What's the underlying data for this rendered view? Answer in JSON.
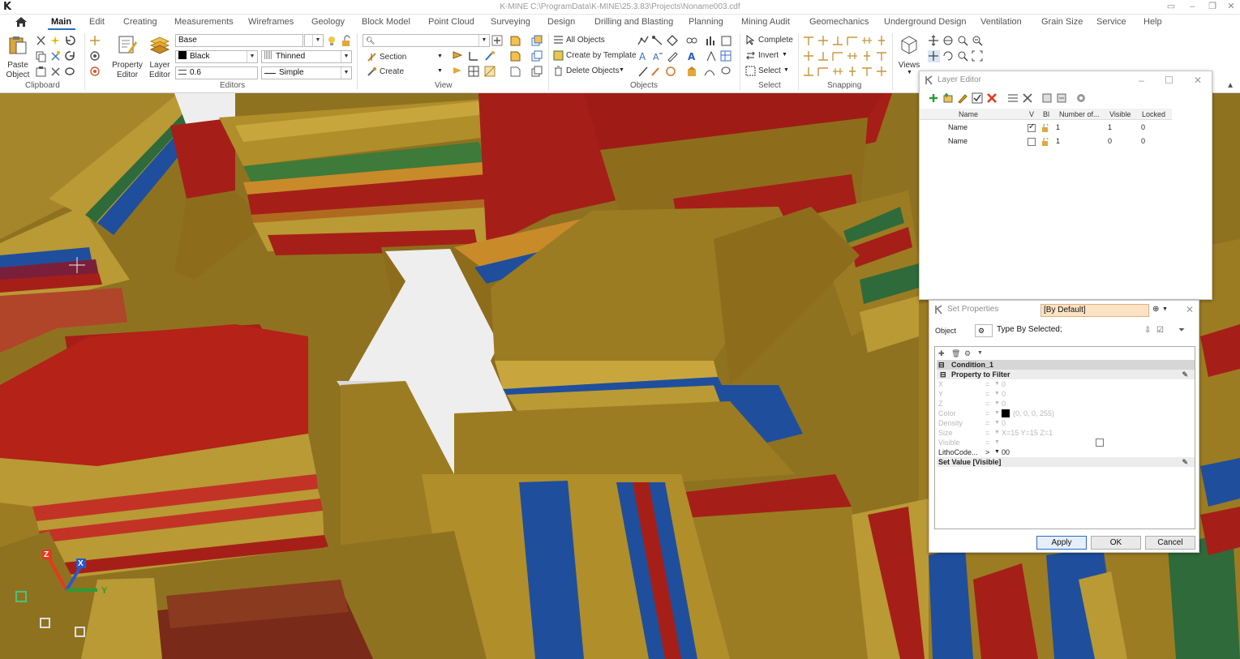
{
  "window": {
    "title": "K-MINE C:\\ProgramData\\K-MINE\\25.3.83\\Projects\\Noname003.cdf",
    "logo": "K"
  },
  "menu": {
    "items": [
      "Main",
      "Edit",
      "Creating",
      "Measurements",
      "Wireframes",
      "Geology",
      "Block Model",
      "Point Cloud",
      "Surveying",
      "Design",
      "Drilling and Blasting",
      "Planning",
      "Mining Audit",
      "Geomechanics",
      "Underground Design",
      "Ventilation",
      "Grain Size",
      "Service",
      "Help"
    ],
    "active": "Main"
  },
  "ribbon": {
    "clipboard": {
      "label": "Clipboard",
      "paste_label": "Paste\nObject"
    },
    "editors": {
      "label": "Editors",
      "property_editor": "Property\nEditor",
      "layer_editor": "Layer\nEditor",
      "layer_combo": "Base",
      "color_combo": "Black",
      "line_type_combo": "Thinned",
      "width_combo": "0.6",
      "style_combo": "Simple"
    },
    "view": {
      "label": "View",
      "search_value": "",
      "section": "Section",
      "create": "Create"
    },
    "objects": {
      "label": "Objects",
      "all_objects": "All Objects",
      "create_by_template": "Create by Template",
      "delete_objects": "Delete Objects"
    },
    "select": {
      "label": "Select",
      "complete": "Complete",
      "invert": "Invert",
      "select": "Select"
    },
    "snapping": {
      "label": "Snapping"
    },
    "views": {
      "label": "Views"
    }
  },
  "layer_editor": {
    "title": "Layer Editor",
    "columns": [
      "Name",
      "V",
      "Bl",
      "Number of...",
      "Visible",
      "Locked"
    ],
    "rows": [
      {
        "name": "Name",
        "v": true,
        "number": "1",
        "visible": "1",
        "locked": "0"
      },
      {
        "name": "Name",
        "v": false,
        "number": "1",
        "visible": "0",
        "locked": "0"
      }
    ]
  },
  "set_properties": {
    "title": "Set Properties",
    "preset": "[By Default]",
    "object_label": "Object",
    "object_value": "Type By Selected;",
    "condition": "Condition_1",
    "property_to_filter": "Property to Filter",
    "props": [
      {
        "name": "X",
        "op": "=",
        "value": "0",
        "enabled": false
      },
      {
        "name": "Y",
        "op": "=",
        "value": "0",
        "enabled": false
      },
      {
        "name": "Z",
        "op": "=",
        "value": "0",
        "enabled": false
      },
      {
        "name": "Color",
        "op": "=",
        "value": "(0, 0, 0, 255)",
        "enabled": false
      },
      {
        "name": "Density",
        "op": "=",
        "value": "0",
        "enabled": false
      },
      {
        "name": "Size",
        "op": "=",
        "value": "X=15 Y=15 Z=1",
        "enabled": false
      },
      {
        "name": "Visible",
        "op": "=",
        "value": "",
        "enabled": false
      },
      {
        "name": "LithoCode...",
        "op": ">",
        "value": "00",
        "enabled": true
      }
    ],
    "set_value": "Set Value [Visible]",
    "apply": "Apply",
    "ok": "OK",
    "cancel": "Cancel"
  },
  "axes": {
    "x": "X",
    "y": "Y",
    "z": "Z"
  },
  "colors": {
    "ochre": "#9c7c22",
    "ochre_light": "#b08e2a",
    "red": "#a51f18",
    "blue": "#1f4f9c",
    "green": "#2f6a3a",
    "white": "#eeeeee",
    "accent": "#2b6cc4"
  }
}
